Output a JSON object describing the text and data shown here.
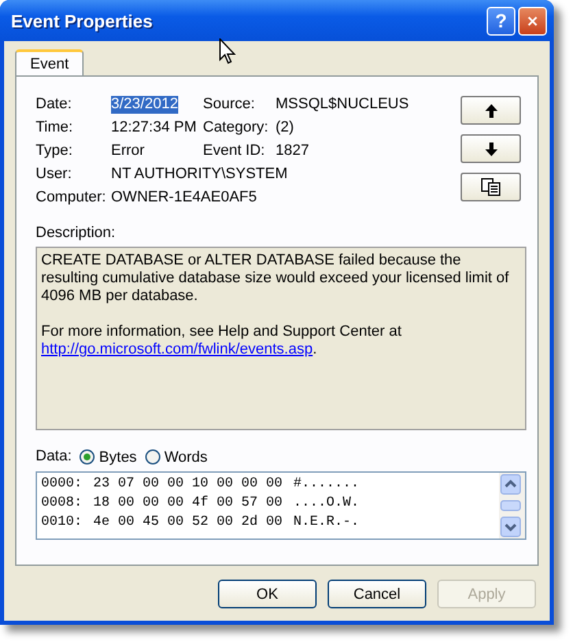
{
  "window": {
    "title": "Event Properties",
    "help": "?"
  },
  "tabs": [
    {
      "label": "Event",
      "selected": true
    }
  ],
  "field_rows": [
    [
      {
        "label": "Date:",
        "value": "3/23/2012",
        "selected": true
      },
      {
        "label": "Source:",
        "value": "MSSQL$NUCLEUS",
        "selected": false
      }
    ],
    [
      {
        "label": "Time:",
        "value": "12:27:34 PM",
        "selected": false
      },
      {
        "label": "Category:",
        "value": "(2)",
        "selected": false
      }
    ],
    [
      {
        "label": "Type:",
        "value": "Error",
        "selected": false
      },
      {
        "label": "Event ID:",
        "value": "1827",
        "selected": false
      }
    ],
    [
      {
        "label": "User:",
        "value": "NT AUTHORITY\\SYSTEM",
        "selected": false
      }
    ],
    [
      {
        "label": "Computer:",
        "value": "OWNER-1E4AE0AF5",
        "selected": false
      }
    ]
  ],
  "side_buttons": [
    {
      "kind": "up"
    },
    {
      "kind": "down"
    },
    {
      "kind": "copy"
    }
  ],
  "description": {
    "label": "Description:",
    "text": "CREATE DATABASE or ALTER DATABASE failed because the resulting cumulative database size would exceed your licensed limit of 4096 MB per database.",
    "more": "For more information, see Help and Support Center at",
    "link": "http://go.microsoft.com/fwlink/events.asp",
    "end": "."
  },
  "data": {
    "label": "Data:",
    "formats": [
      {
        "label": "Bytes",
        "selected": true
      },
      {
        "label": "Words",
        "selected": false
      }
    ],
    "lines": [
      {
        "offset": "0000:",
        "bytes": "23 07 00 00 10 00 00 00",
        "ascii": "#......."
      },
      {
        "offset": "0008:",
        "bytes": "18 00 00 00 4f 00 57 00",
        "ascii": "....O.W."
      },
      {
        "offset": "0010:",
        "bytes": "4e 00 45 00 52 00 2d 00",
        "ascii": "N.E.R.-."
      }
    ]
  },
  "buttons": [
    {
      "label": "OK",
      "disabled": false
    },
    {
      "label": "Cancel",
      "disabled": false
    },
    {
      "label": "Apply",
      "disabled": true
    }
  ]
}
